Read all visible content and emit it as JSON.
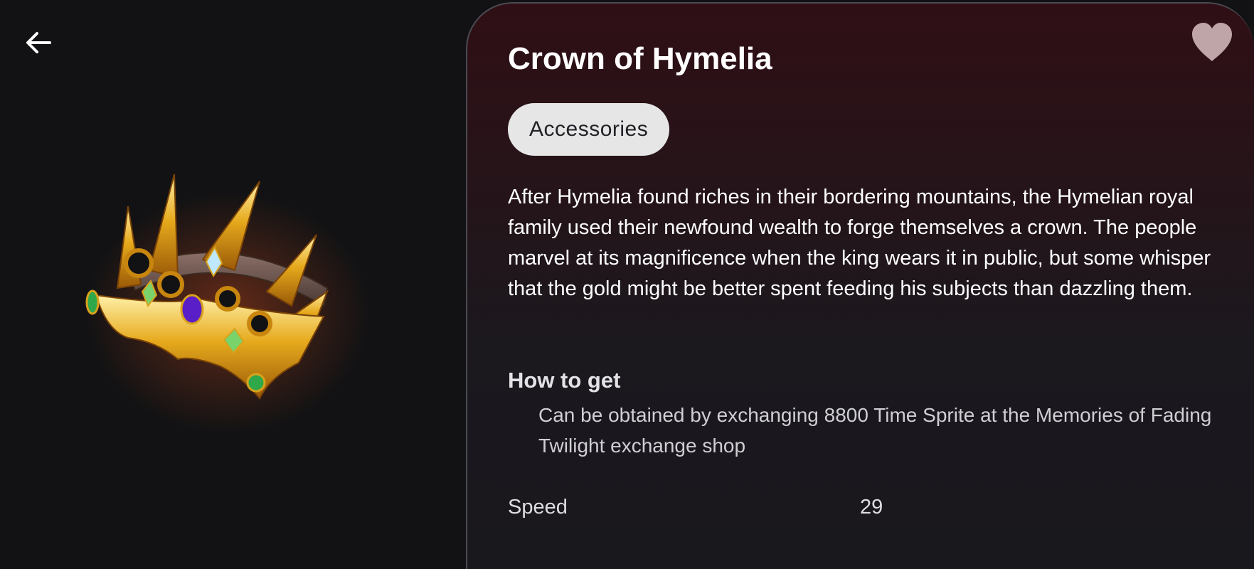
{
  "icons": {
    "back": "arrow-left-icon",
    "favorite": "heart-icon"
  },
  "colors": {
    "background": "#121214",
    "panel_top": "#2f0f15",
    "panel_bottom": "#19181d",
    "tag_background": "#e6e6e7",
    "heart": "#bfa4a8"
  },
  "item": {
    "name": "Crown of Hymelia",
    "category": "Accessories",
    "description": "After Hymelia found riches in their bordering mountains, the Hymelian royal family used their newfound wealth to forge themselves a crown. The people marvel at its magnificence when the king wears it in public, but some whisper that the gold might be better spent feeding his subjects than dazzling them.",
    "how_to_get": {
      "heading": "How to get",
      "text": "Can be obtained by exchanging 8800 Time Sprite at the Memories of Fading Twilight exchange shop"
    },
    "stats": [
      {
        "label": "Speed",
        "value": "29"
      }
    ]
  }
}
